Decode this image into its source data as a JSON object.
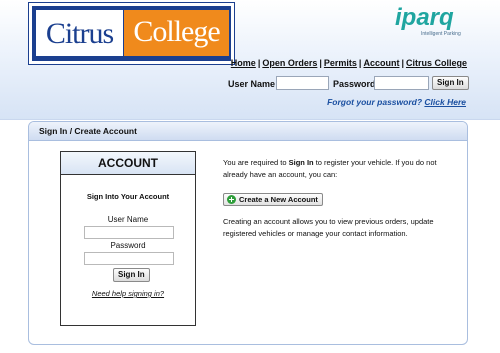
{
  "logo": {
    "left_text": "Citrus",
    "right_text": "College"
  },
  "brand": {
    "name": "iparq",
    "tagline": "Intelligent Parking"
  },
  "nav": {
    "home": "Home",
    "open_orders": "Open Orders",
    "permits": "Permits",
    "account": "Account",
    "citrus_college": "Citrus College",
    "separator": "|"
  },
  "header_login": {
    "username_label": "User Name",
    "password_label": "Password",
    "sign_in_label": "Sign In",
    "forgot_text": "Forgot your password?",
    "click_here": "Click Here"
  },
  "panel": {
    "title": "Sign In / Create Account"
  },
  "account_box": {
    "title": "ACCOUNT",
    "subtitle": "Sign Into Your Account",
    "username_label": "User Name",
    "password_label": "Password",
    "sign_in_label": "Sign In",
    "help_link": "Need help signing in?"
  },
  "info": {
    "intro_before": "You are required to ",
    "intro_strong": "Sign In",
    "intro_after": " to register your vehicle. If you do not already have an account, you can:",
    "create_button": "Create a New Account",
    "details": "Creating an account allows you to view previous orders, update registered vehicles or manage your contact information."
  },
  "colors": {
    "brand_blue": "#1b3f8f",
    "brand_orange": "#f08a1c",
    "iparq_teal": "#1fa5a0",
    "link_blue": "#1a4fa0",
    "create_icon_green": "#2e9e3a"
  },
  "icons": {
    "create_button_icon": "plus-circle-icon"
  }
}
